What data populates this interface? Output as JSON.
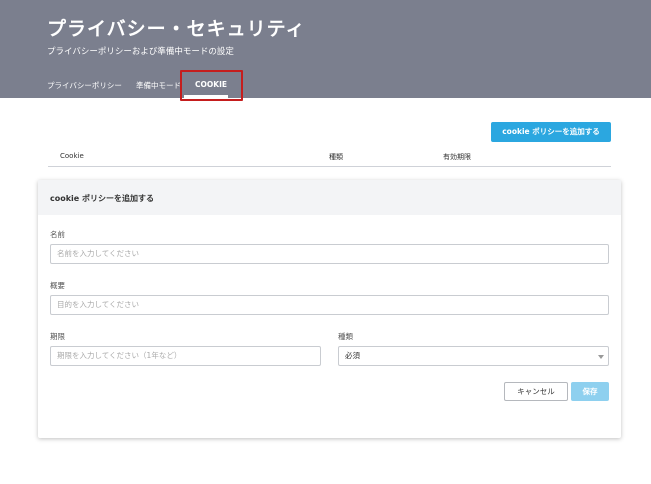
{
  "header": {
    "title": "プライバシー・セキュリティ",
    "subtitle": "プライバシーポリシーおよび準備中モードの設定",
    "tabs": [
      {
        "label": "プライバシーポリシー"
      },
      {
        "label": "準備中モード"
      },
      {
        "label": "COOKIE",
        "active": true
      }
    ]
  },
  "toolbar": {
    "add_cookie_label": "cookie ポリシーを追加する"
  },
  "table": {
    "columns": [
      "Cookie",
      "種類",
      "有効期限"
    ]
  },
  "form": {
    "title": "cookie ポリシーを追加する",
    "name": {
      "label": "名前",
      "placeholder": "名前を入力してください"
    },
    "description": {
      "label": "概要",
      "placeholder": "目的を入力してください"
    },
    "expiry": {
      "label": "期限",
      "placeholder": "期限を入力してください（1年など）"
    },
    "type": {
      "label": "種類",
      "value": "必須"
    },
    "cancel_label": "キャンセル",
    "save_label": "保存"
  },
  "colors": {
    "header_bg": "#7b7f8e",
    "accent": "#2ba7e0",
    "save_disabled": "#8ed0ef",
    "highlight": "#c51d1d"
  }
}
